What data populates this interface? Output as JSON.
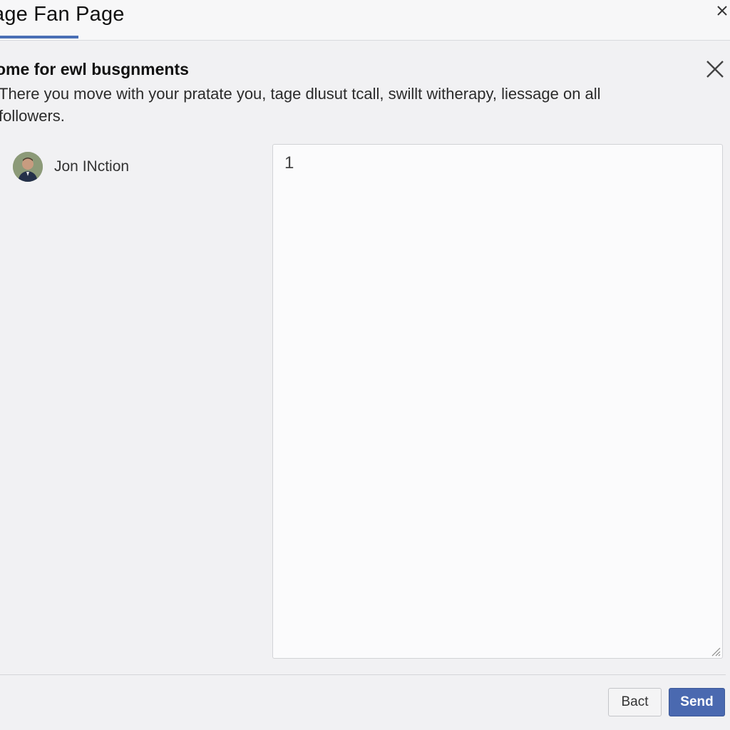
{
  "header": {
    "title": "age Fan Page",
    "accent_color": "#4a6fb5",
    "close_icon": "close-icon"
  },
  "dialog": {
    "title": "ome for ewl busgnments",
    "description": "There you move with your pratate you, tage dlusut tcall, swillt witherapy, liessage on all followers.",
    "close_icon": "close-icon"
  },
  "recipient": {
    "name": "Jon INction",
    "avatar_icon": "avatar"
  },
  "message": {
    "value": "1",
    "resize_icon": "resize-grip-icon"
  },
  "footer": {
    "back_label": "Bact",
    "send_label": "Send",
    "send_color": "#4a69b0"
  }
}
